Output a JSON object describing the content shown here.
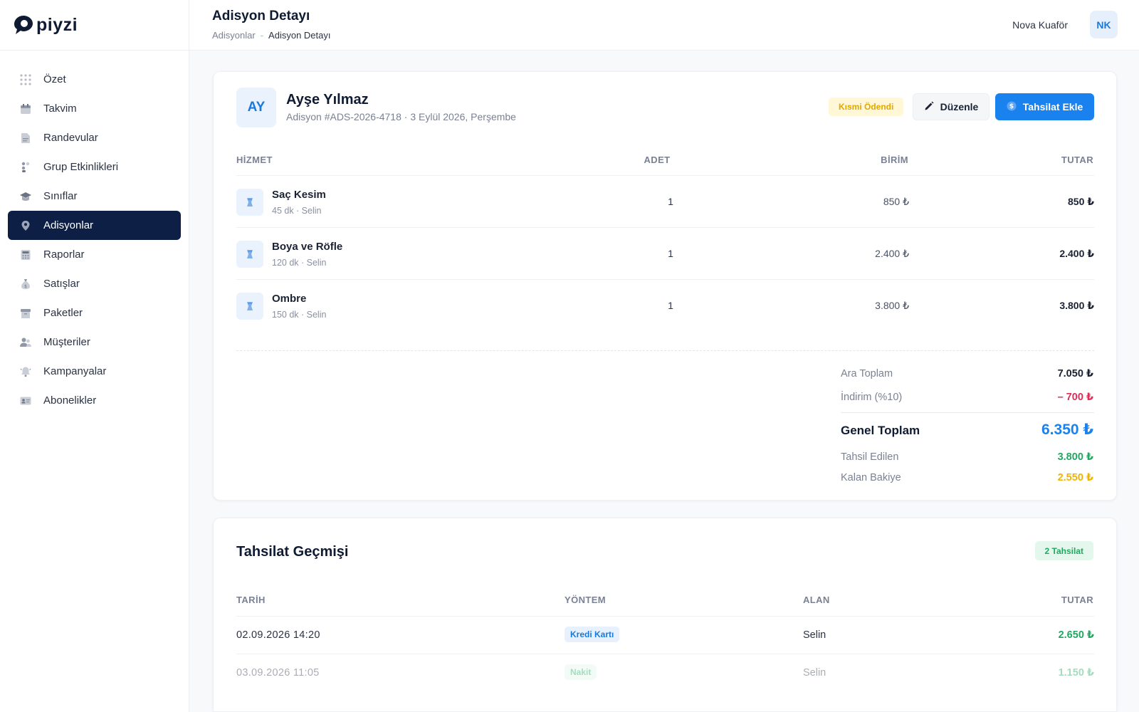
{
  "app": {
    "logo_text": "piyzi"
  },
  "sidebar": {
    "items": [
      {
        "label": "Özet",
        "icon": "grid-icon"
      },
      {
        "label": "Takvim",
        "icon": "calendar-icon"
      },
      {
        "label": "Randevular",
        "icon": "document-icon"
      },
      {
        "label": "Grup Etkinlikleri",
        "icon": "group-icon"
      },
      {
        "label": "Sınıflar",
        "icon": "graduation-cap-icon"
      },
      {
        "label": "Adisyonlar",
        "icon": "pin-icon",
        "active": true
      },
      {
        "label": "Raporlar",
        "icon": "calculator-icon"
      },
      {
        "label": "Satışlar",
        "icon": "money-bag-icon"
      },
      {
        "label": "Paketler",
        "icon": "package-icon"
      },
      {
        "label": "Müşteriler",
        "icon": "users-icon"
      },
      {
        "label": "Kampanyalar",
        "icon": "bell-icon"
      },
      {
        "label": "Abonelikler",
        "icon": "id-card-icon"
      }
    ]
  },
  "header": {
    "title": "Adisyon Detayı",
    "breadcrumb": {
      "parent": "Adisyonlar",
      "separator": "-",
      "current": "Adisyon Detayı"
    },
    "user_name": "Nova Kuaför",
    "user_initials": "NK"
  },
  "receipt": {
    "customer_initials": "AY",
    "customer_name": "Ayşe Yılmaz",
    "meta": "Adisyon #ADS-2026-4718 · 3 Eylül 2026, Perşembe",
    "status": "Kısmi Ödendi",
    "edit_label": "Düzenle",
    "pay_label": "Tahsilat Ekle",
    "columns": {
      "service": "HİZMET",
      "qty": "ADET",
      "unit": "BİRİM",
      "total": "TUTAR"
    },
    "items": [
      {
        "name": "Saç Kesim",
        "sub": "45 dk · Selin",
        "qty": "1",
        "unit": "850 ₺",
        "total": "850 ₺"
      },
      {
        "name": "Boya ve Röfle",
        "sub": "120 dk · Selin",
        "qty": "1",
        "unit": "2.400 ₺",
        "total": "2.400 ₺"
      },
      {
        "name": "Ombre",
        "sub": "150 dk · Selin",
        "qty": "1",
        "unit": "3.800 ₺",
        "total": "3.800 ₺"
      }
    ],
    "summary": {
      "subtotal_label": "Ara Toplam",
      "subtotal": "7.050 ₺",
      "discount_label": "İndirim (%10)",
      "discount": "– 700 ₺",
      "grand_label": "Genel Toplam",
      "grand": "6.350 ₺",
      "collected_label": "Tahsil Edilen",
      "collected": "3.800 ₺",
      "balance_label": "Kalan Bakiye",
      "balance": "2.550 ₺"
    }
  },
  "history": {
    "title": "Tahsilat Geçmişi",
    "count_badge": "2 Tahsilat",
    "columns": {
      "date": "TARİH",
      "method": "YÖNTEM",
      "by": "ALAN",
      "amount": "TUTAR"
    },
    "rows": [
      {
        "date": "02.09.2026 14:20",
        "method": "Kredi Kartı",
        "by": "Selin",
        "amount": "2.650 ₺"
      },
      {
        "date": "03.09.2026 11:05",
        "method": "Nakit",
        "by": "Selin",
        "amount": "1.150 ₺"
      }
    ]
  },
  "colors": {
    "primary": "#1a82ee",
    "nav_active": "#0d1f45",
    "success": "#22a760",
    "warning": "#f0b400",
    "danger": "#e02d55"
  }
}
